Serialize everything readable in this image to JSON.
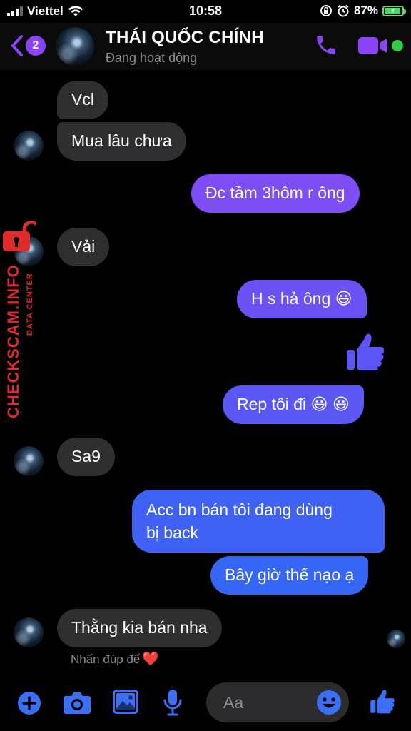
{
  "status_bar": {
    "carrier": "Viettel",
    "time": "10:58",
    "battery_percent": "87%"
  },
  "header": {
    "back_badge_count": "2",
    "contact_name": "THÁI QUỐC CHÍNH",
    "contact_status": "Đang hoạt động",
    "accent_color": "#8b44f5",
    "active_dot_color": "#31cc46"
  },
  "messages": [
    {
      "from": "contact",
      "text": "Vcl"
    },
    {
      "from": "contact",
      "text": "Mua lâu chưa"
    },
    {
      "from": "me",
      "text": "Đc tầm 3hôm r ông"
    },
    {
      "from": "contact",
      "text": "Vải"
    },
    {
      "from": "me",
      "text": "H s hả ông 😃"
    },
    {
      "from": "me",
      "type": "thumbs-up-sticker"
    },
    {
      "from": "me",
      "text": "Rep tôi đi 😃 😃"
    },
    {
      "from": "contact",
      "text": "Sa9"
    },
    {
      "from": "me",
      "text": "Acc bn bán tôi đang dùng bị back",
      "lines": [
        "Acc bn bán tôi đang dùng",
        "bị back"
      ]
    },
    {
      "from": "me",
      "text": "Bây giờ thế nạo ạ"
    },
    {
      "from": "contact",
      "text": "Thằng kia bán nha"
    }
  ],
  "reaction_hint": {
    "text": "Nhấn đúp để",
    "emoji": "❤️"
  },
  "watermark": {
    "main": "CHECKSCAM.INFO",
    "sub": "DATA CENTER"
  },
  "composer": {
    "placeholder": "Aa",
    "icons": [
      "plus-icon",
      "camera-icon",
      "photo-icon",
      "microphone-icon",
      "emoji-icon",
      "thumbs-up-icon"
    ]
  },
  "colors": {
    "received_bubble": "#2f2f31",
    "sent_gradient_top": "#8b44f5",
    "sent_gradient_bottom": "#2f6cf5"
  }
}
